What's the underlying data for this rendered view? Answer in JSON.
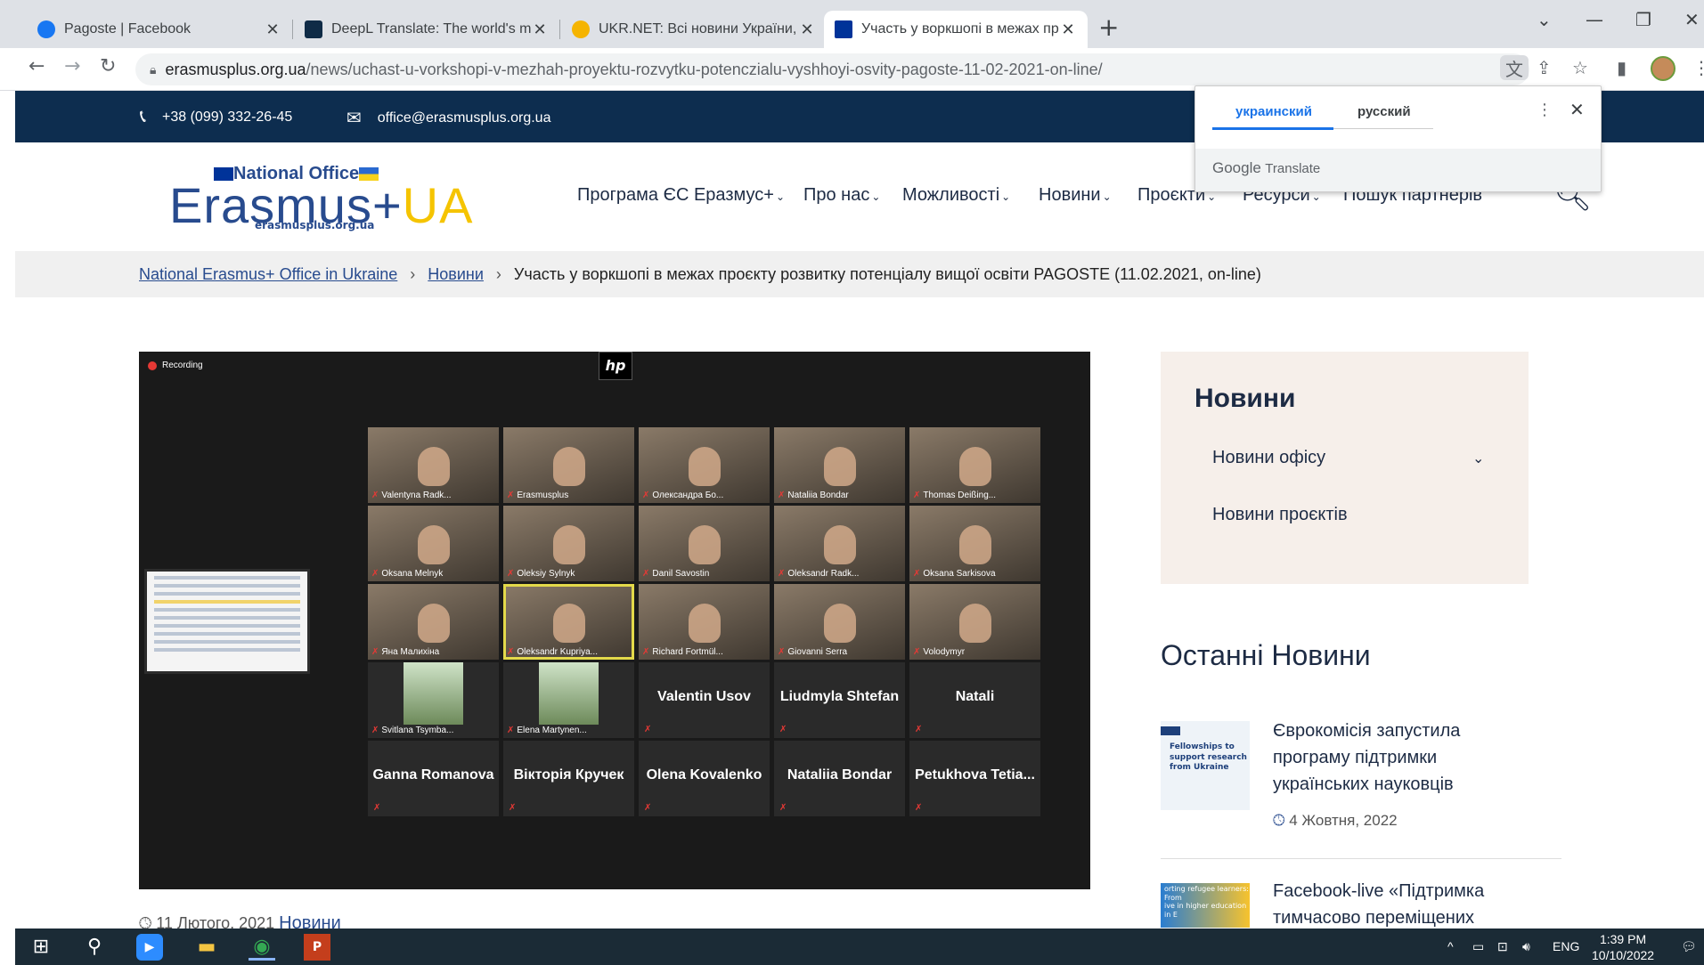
{
  "browser": {
    "tabs": [
      {
        "title": "Pagoste | Facebook",
        "favicon_color": "#1877f2"
      },
      {
        "title": "DeepL Translate: The world's most",
        "favicon_color": "#0f2b46"
      },
      {
        "title": "UKR.NET: Всі новини України, ос",
        "favicon_color": "#f5b400"
      },
      {
        "title": "Участь у воркшопі в межах прое",
        "favicon_color": "#003399"
      }
    ],
    "new_tab": "+",
    "url_host": "erasmusplus.org.ua",
    "url_path": "/news/uchast-u-vorkshopi-v-mezhah-proyektu-rozvytku-potenczialu-vyshhoyi-osvity-pagoste-11-02-2021-on-line/"
  },
  "translate_popup": {
    "lang_active": "украинский",
    "lang_other": "русский",
    "brand_google": "Google",
    "brand_translate": "Translate"
  },
  "topbar": {
    "phone": "+38 (099) 332-26-45",
    "email": "office@erasmusplus.org.ua"
  },
  "logo": {
    "national_office": "National Office",
    "erasmus": "Erasmus+",
    "ua": "UA",
    "url": "erasmusplus.org.ua"
  },
  "nav": [
    "Програма ЄС Еразмус+",
    "Про нас",
    "Можливості",
    "Новини",
    "Проєкти",
    "Ресурси",
    "Пошук партнерів"
  ],
  "breadcrumb": {
    "home": "National Erasmus+ Office in Ukraine",
    "section": "Новини",
    "current": "Участь у воркшопі в межах проєкту розвитку потенціалу вищої освіти PAGOSTE (11.02.2021, on-line)"
  },
  "video": {
    "recording_label": "Recording",
    "hp_label": "hp",
    "participants": [
      {
        "name": "Valentyna Radk...",
        "cam": true
      },
      {
        "name": "Erasmusplus",
        "cam": true
      },
      {
        "name": "Олександра Бо...",
        "cam": true
      },
      {
        "name": "Nataliia Bondar",
        "cam": true
      },
      {
        "name": "Thomas Deißing...",
        "cam": true
      },
      {
        "name": "Oksana Melnyk",
        "cam": true
      },
      {
        "name": "Oleksiy Sylnyk",
        "cam": true
      },
      {
        "name": "Danil Savostin",
        "cam": true
      },
      {
        "name": "Oleksandr Radk...",
        "cam": true
      },
      {
        "name": "Oksana Sarkisova",
        "cam": true
      },
      {
        "name": "Яна Малихіна",
        "cam": true
      },
      {
        "name": "Oleksandr Kupriya...",
        "cam": true,
        "speaking": true
      },
      {
        "name": "Richard Fortmül...",
        "cam": true
      },
      {
        "name": "Giovanni Serra",
        "cam": true
      },
      {
        "name": "Volodymyr",
        "cam": true
      },
      {
        "name": "Svitlana Tsymba...",
        "cam": "photo"
      },
      {
        "name": "Elena Martynen...",
        "cam": "photo"
      },
      {
        "name": "Valentin Usov",
        "cam": false
      },
      {
        "name": "Liudmyla Shtefan",
        "cam": false
      },
      {
        "name": "Natali",
        "cam": false
      },
      {
        "name": "Ganna Romanova",
        "cam": false
      },
      {
        "name": "Вікторія Кручек",
        "cam": false
      },
      {
        "name": "Olena Kovalenko",
        "cam": false
      },
      {
        "name": "Nataliia Bondar",
        "cam": false
      },
      {
        "name": "Petukhova  Tetia...",
        "cam": false
      }
    ]
  },
  "post_meta": {
    "date": "11 Лютого, 2021",
    "category": "Новини"
  },
  "sidebar": {
    "title": "Новини",
    "items": [
      "Новини офісу",
      "Новини проєктів"
    ],
    "latest_title": "Останні Новини",
    "news": [
      {
        "title_lines": [
          "Єврокомісія запустила",
          "програму підтримки",
          "українських науковців"
        ],
        "date": "4 Жовтня, 2022",
        "thumb_text": [
          "Fellowships to",
          "support research",
          "from Ukraine"
        ]
      },
      {
        "title_lines": [
          "Facebook-live «Підтримка",
          "тимчасово переміщених"
        ],
        "thumb_text": [
          "orting refugee learners: From",
          "ive in higher education in E"
        ]
      }
    ]
  },
  "taskbar": {
    "lang": "ENG",
    "time": "1:39 PM",
    "date": "10/10/2022"
  },
  "colors": {
    "site_navy": "#0d2d4f",
    "brand_blue": "#284b8e",
    "brand_yellow": "#f5c400",
    "translate_blue": "#1a73e8"
  }
}
